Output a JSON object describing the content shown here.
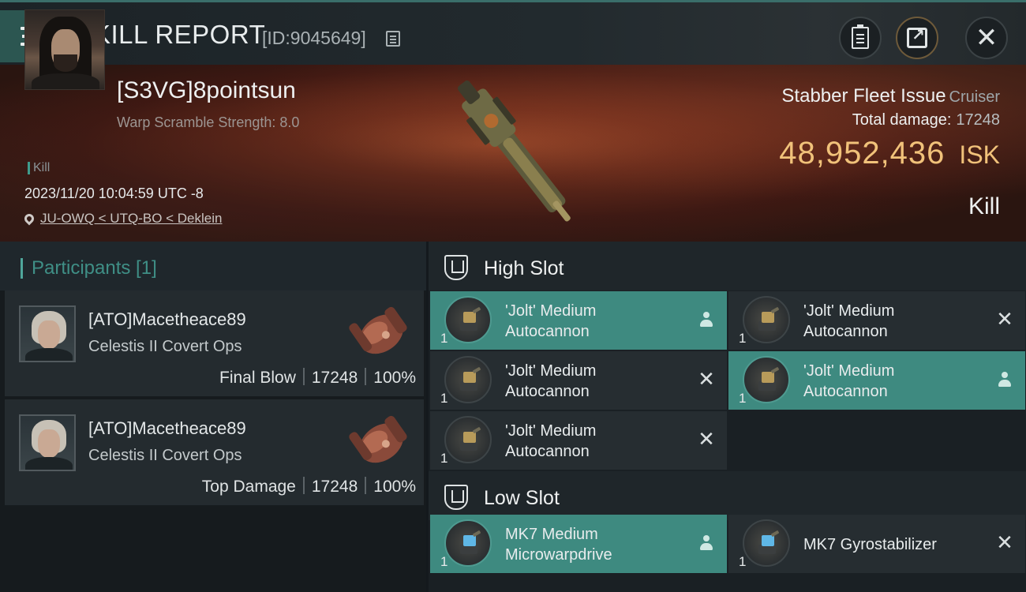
{
  "header": {
    "title": "KILL REPORT",
    "report_id": "[ID:9045649]"
  },
  "victim": {
    "name": "[S3VG]8pointsun",
    "scramble": "Warp Scramble Strength: 8.0",
    "tag": "Kill",
    "date": "2023/11/20 10:04:59 UTC -8",
    "location": "JU-OWQ < UTQ-BO < Deklein",
    "ship_name": "Stabber Fleet Issue",
    "ship_class": "Cruiser",
    "total_damage_label": "Total damage:",
    "total_damage_value": "17248",
    "isk_value": "48,952,436",
    "isk_unit": "ISK",
    "result": "Kill"
  },
  "participants": {
    "title": "Participants [1]",
    "items": [
      {
        "name": "[ATO]Macetheace89",
        "ship": "Celestis II Covert Ops",
        "role": "Final Blow",
        "damage": "17248",
        "percent": "100%"
      },
      {
        "name": "[ATO]Macetheace89",
        "ship": "Celestis II Covert Ops",
        "role": "Top Damage",
        "damage": "17248",
        "percent": "100%"
      }
    ]
  },
  "slots": {
    "high_title": "High Slot",
    "low_title": "Low Slot",
    "high": [
      {
        "line1": "'Jolt' Medium",
        "line2": "Autocannon",
        "qty": "1",
        "status": "person-icon",
        "active": true
      },
      {
        "line1": "'Jolt' Medium",
        "line2": "Autocannon",
        "qty": "1",
        "status": "close-icon",
        "active": false
      },
      {
        "line1": "'Jolt' Medium",
        "line2": "Autocannon",
        "qty": "1",
        "status": "close-icon",
        "active": false
      },
      {
        "line1": "'Jolt' Medium",
        "line2": "Autocannon",
        "qty": "1",
        "status": "person-icon",
        "active": true
      },
      {
        "line1": "'Jolt' Medium",
        "line2": "Autocannon",
        "qty": "1",
        "status": "close-icon",
        "active": false
      }
    ],
    "low": [
      {
        "line1": "MK7 Medium",
        "line2": "Microwarpdrive",
        "qty": "1",
        "status": "person-icon",
        "active": true
      },
      {
        "line1": "MK7 Gyrostabilizer",
        "line2": "",
        "qty": "1",
        "status": "close-icon",
        "active": false
      }
    ]
  },
  "colors": {
    "accent": "#3e8a80",
    "isk": "#f1c27a",
    "banner": "#6f2d1b"
  }
}
